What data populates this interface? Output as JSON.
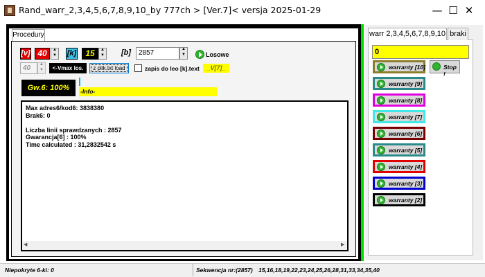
{
  "window": {
    "title": "Rand_warr_2,3,4,5,6,7,8,9,10_by 777ch > [Ver.7]<   versja 2025-01-29",
    "minimize": "—",
    "maximize": "☐",
    "close": "✕"
  },
  "left": {
    "tab_label": "Procedury",
    "v_label": "[v]",
    "v_value": "40",
    "k_label": "[k]",
    "k_value": "15",
    "b_label": "[b]",
    "b_value": "2857",
    "losowe_label": "Losowe",
    "vmax_value": "40",
    "vmax_button": "<-Vmax los.",
    "load_button": "z plik.txt load",
    "zapis_label": "zapis do leo [k].text",
    "v7_label": "_V[7]_",
    "gw_label": "Gw.6: 100%",
    "info_label": "-Info-",
    "output_lines": [
      "Max adres6/kod6: 3838380",
      "Brak6: 0",
      "",
      "Liczba linii sprawdzanych : 2857",
      "Gwarancja[6] : 100%",
      "Time calculated : 31,2832542 s"
    ]
  },
  "right": {
    "tab_warr": "warr 2,3,4,5,6,7,8,9,10",
    "tab_braki": "braki",
    "yellow_value": "0",
    "stop_button": "Stop !",
    "warranty_buttons": [
      {
        "label": "warranty [10]",
        "border": "#8b7d2a"
      },
      {
        "label": "warranty [9]",
        "border": "#2a8a8a"
      },
      {
        "label": "warranty [8]",
        "border": "#e000e0"
      },
      {
        "label": "warranty [7]",
        "border": "#40e8e8"
      },
      {
        "label": "warranty [6]",
        "border": "#7a0000"
      },
      {
        "label": "warranty [5]",
        "border": "#2a8a8a"
      },
      {
        "label": "warranty [4]",
        "border": "#e00000"
      },
      {
        "label": "warranty [3]",
        "border": "#0000d0"
      },
      {
        "label": "warranty [2]",
        "border": "#000000"
      }
    ]
  },
  "status": {
    "left": "Niepokryte 6-ki: 0",
    "sekwencja_label": "Sekwencja nr:(2857)",
    "sekwencja_value": "15,16,18,19,22,23,24,25,26,28,31,33,34,35,40"
  },
  "colors": {
    "accent_green": "#00e000",
    "yellow": "#ffff00",
    "v_red": "#e00000",
    "k_black": "#000000"
  }
}
